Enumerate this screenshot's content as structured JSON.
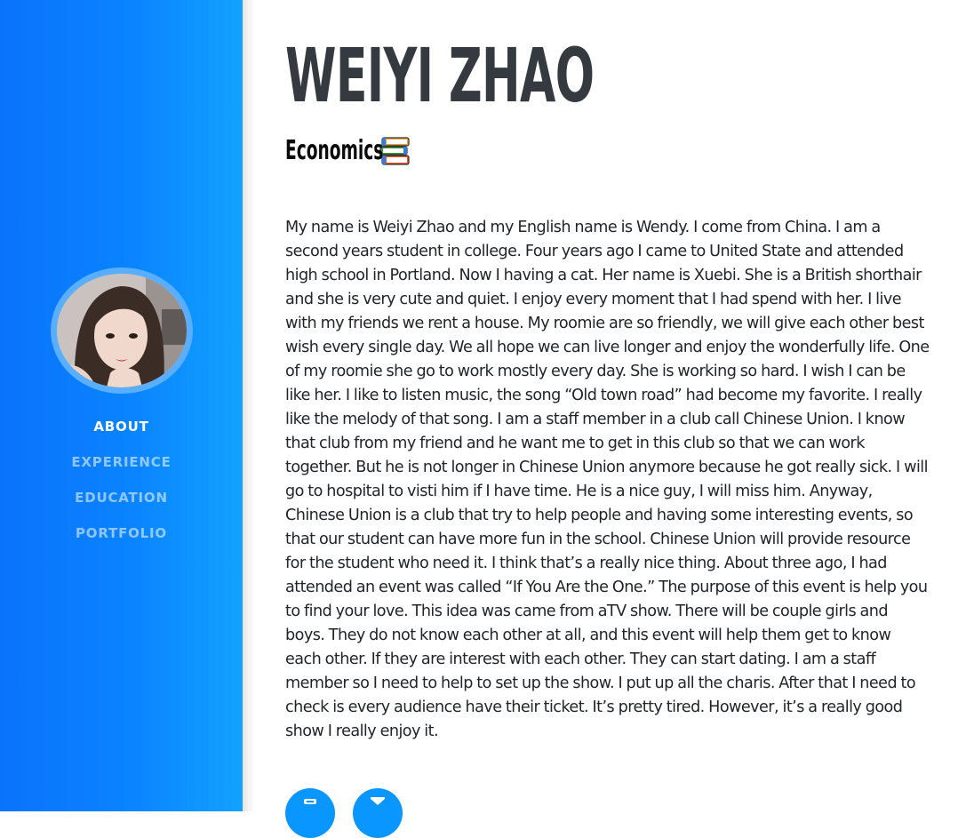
{
  "profile": {
    "name": "WEIYI ZHAO",
    "major": "Economics",
    "major_icon": "books-icon",
    "bio": "My name is Weiyi Zhao and my English name is Wendy. I come from China. I am a second years student in college. Four years ago I came to United State and attended high school in Portland. Now I having a cat. Her name is Xuebi. She is a British shorthair and she is very cute and quiet. I enjoy every moment that I had spend with her. I live with my friends we rent a house. My roomie are so friendly, we will give each other best wish every single day. We all hope we can live longer and enjoy the wonderfully life. One of my roomie she go to work mostly every day. She is working so hard. I wish I can be like her. I like to listen music, the song “Old town road” had become my favorite. I really like the melody of that song. I am a staff member in a club call Chinese Union. I know that club from my friend and he want me to get in this club so that we can work together. But he is not longer in Chinese Union anymore because he got really sick. I will go to hospital to visti him if I have time. He is a nice guy, I will miss him. Anyway, Chinese Union is a club that try to help people and having some interesting events, so that our student can have more fun in the school. Chinese Union will provide resource for the student who need it. I think that’s a really nice thing. About three ago, I had attended an event was called “If You Are the One.” The purpose of this event is help you to find your love. This idea was came from aTV show. There will be couple girls and boys. They do not know each other at all, and this event will help them get to know each other. If they are interest with each other. They can start dating. I am a staff member so I need to help to set up the show. I put up all the charis. After that I need to check is every audience have their ticket. It’s pretty tired. However, it’s a really good show I really enjoy it."
  },
  "sidebar": {
    "nav": [
      {
        "label": "ABOUT",
        "active": true
      },
      {
        "label": "EXPERIENCE",
        "active": false
      },
      {
        "label": "EDUCATION",
        "active": false
      },
      {
        "label": "PORTFOLIO",
        "active": false
      }
    ]
  },
  "social": {
    "icons": [
      "social-icon-1",
      "social-icon-2"
    ]
  },
  "colors": {
    "sidebar": "#0a84ff",
    "accent": "#0a96ff",
    "heading": "#343a40",
    "text": "#212529"
  }
}
